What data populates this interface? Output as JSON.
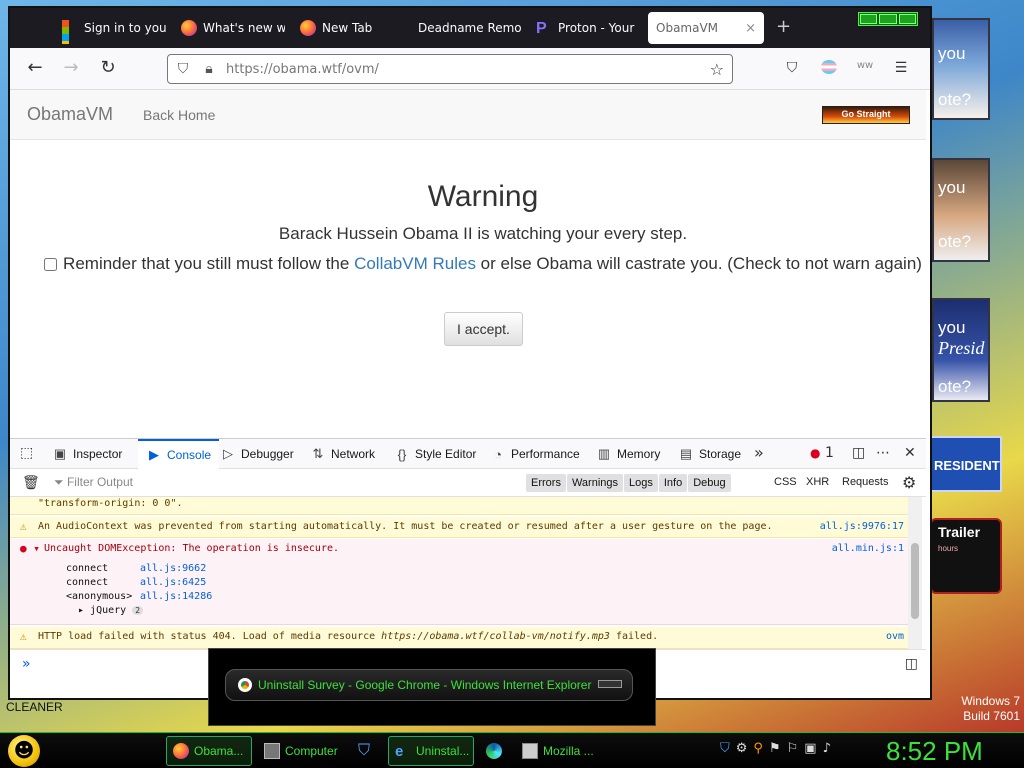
{
  "browser": {
    "tabs": [
      {
        "label": "Sign in to your",
        "icon": "microsoft-icon"
      },
      {
        "label": "What's new w",
        "icon": "firefox-icon"
      },
      {
        "label": "New Tab",
        "icon": "firefox-icon"
      },
      {
        "label": "Deadname Remov",
        "icon": "none"
      },
      {
        "label": "Proton - Your",
        "icon": "proton-icon"
      },
      {
        "label": "ObamaVM",
        "icon": "none",
        "active": true
      }
    ],
    "tab_close": "×",
    "new_tab": "+",
    "url": "https://obama.wtf/ovm/",
    "accent": "#0060df"
  },
  "site": {
    "brand": "ObamaVM",
    "back_home": "Back Home",
    "badge": "Go Straight",
    "warning_title": "Warning",
    "warning_sub": "Barack Hussein Obama II is watching your every step.",
    "reminder_pre": "Reminder that you still must follow the ",
    "reminder_link": "CollabVM Rules",
    "reminder_post": " or else Obama will castrate you. (Check to not warn again)",
    "accept": "I accept."
  },
  "devtools": {
    "tabs": [
      "Inspector",
      "Console",
      "Debugger",
      "Network",
      "Style Editor",
      "Performance",
      "Memory",
      "Storage"
    ],
    "active_tab": "Console",
    "error_count": "1",
    "filter_placeholder": "Filter Output",
    "chips": [
      "Errors",
      "Warnings",
      "Logs",
      "Info",
      "Debug"
    ],
    "plain": [
      "CSS",
      "XHR",
      "Requests"
    ],
    "messages": {
      "top": "\"transform-origin: 0 0\".",
      "audio": "An AudioContext was prevented from starting automatically. It must be created or resumed after a user gesture on the page.",
      "audio_src": "all.js:9976:17",
      "err": "Uncaught DOMException: The operation is insecure.",
      "err_src": "all.min.js:1",
      "stack": [
        {
          "fn": "connect",
          "loc": "all.js:9662"
        },
        {
          "fn": "connect",
          "loc": "all.js:6425"
        },
        {
          "fn": "<anonymous>",
          "loc": "all.js:14286"
        }
      ],
      "jquery": "jQuery",
      "jquery_count": "2",
      "http_pre": "HTTP load failed with status 404. Load of media resource ",
      "http_url": "https://obama.wtf/collab-vm/notify.mp3",
      "http_post": " failed.",
      "http_src": "ovm"
    },
    "prompt": "»"
  },
  "desktop": {
    "tile1": {
      "l1": "you",
      "l2": "ote?"
    },
    "tile2": {
      "l1": "you",
      "l2": "ote?"
    },
    "tile3": {
      "l1": "you",
      "l1b": "Presid",
      "l2": "ote?"
    },
    "president": "RESIDENT",
    "trailer": "Trailer",
    "trailer_sub": "hours",
    "watermark_1": "Windows 7",
    "watermark_2": "Build 7601",
    "cleaner": "CLEANER"
  },
  "survey": {
    "title": "Uninstall Survey - Google Chrome - Windows Internet Explorer"
  },
  "taskbar": {
    "items": [
      {
        "label": "Obama...",
        "icon": "firefox-icon"
      },
      {
        "label": "Computer",
        "icon": "computer-icon"
      },
      {
        "label": "",
        "icon": "shield-icon"
      },
      {
        "label": "Uninstal...",
        "icon": "ie-icon"
      },
      {
        "label": "",
        "icon": "edge-icon"
      },
      {
        "label": "Mozilla ...",
        "icon": "window-icon"
      }
    ],
    "clock": "8:52 PM"
  }
}
